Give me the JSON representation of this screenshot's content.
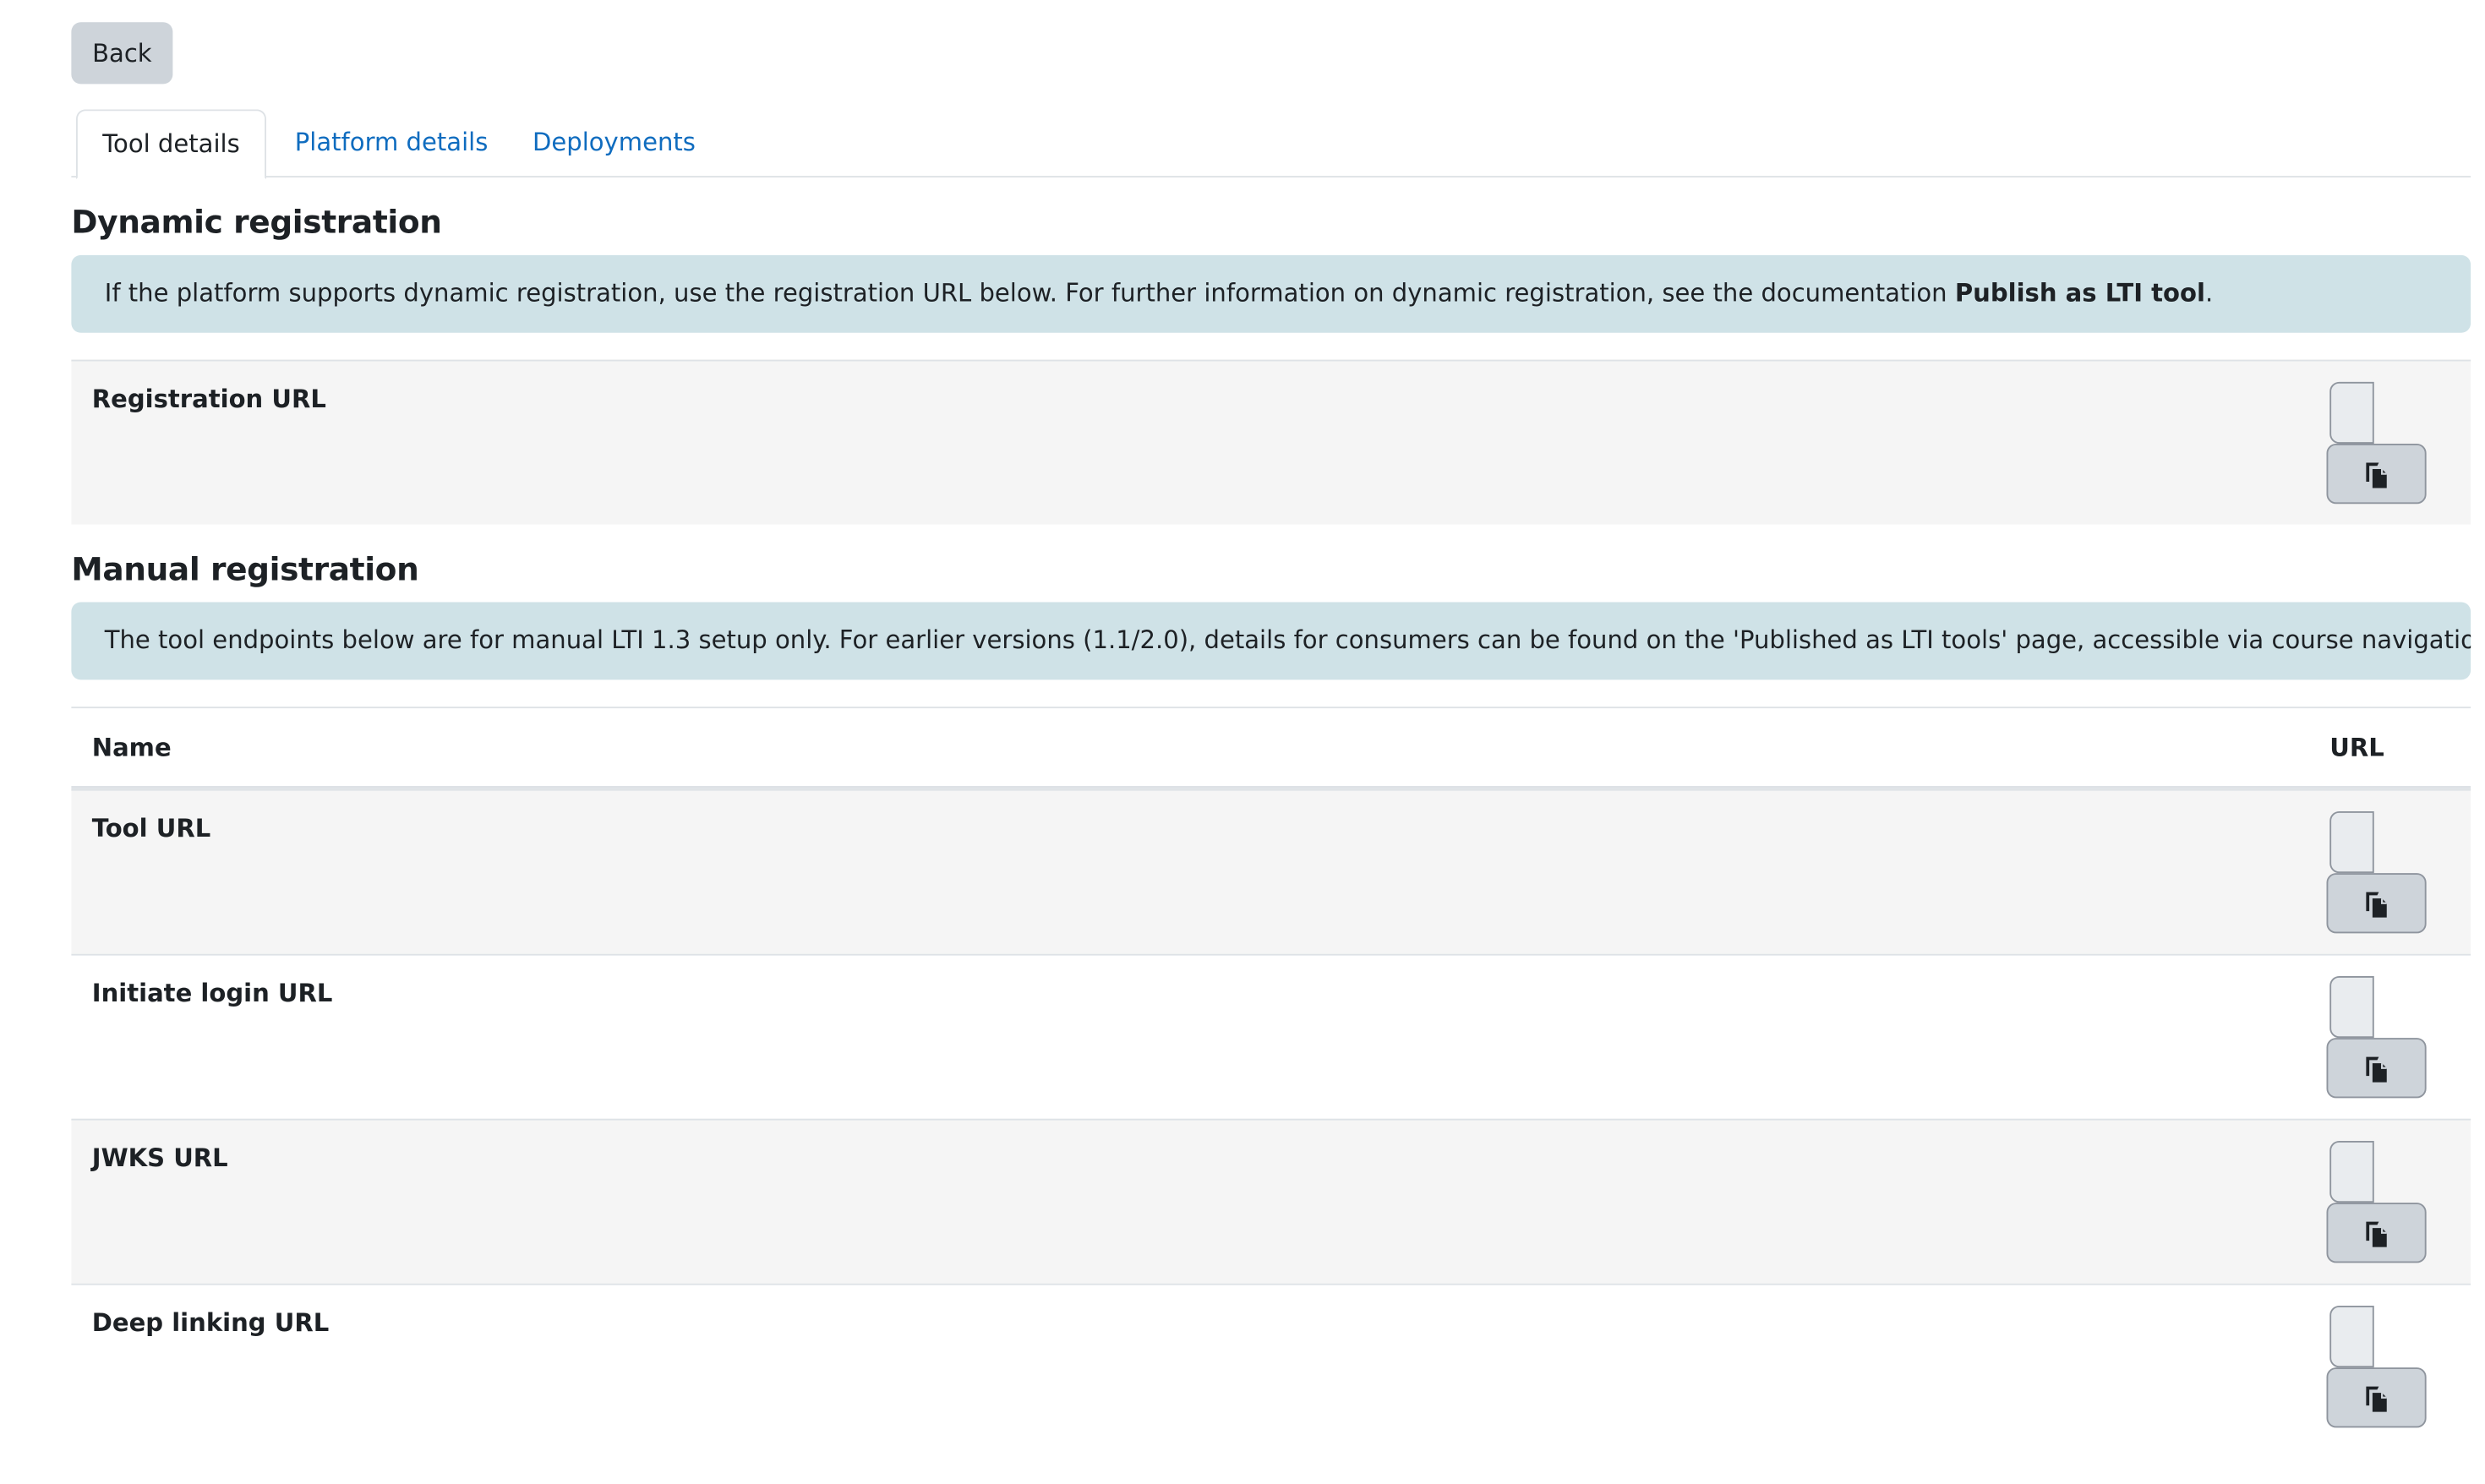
{
  "back_label": "Back",
  "tabs": [
    {
      "label": "Tool details",
      "active": true
    },
    {
      "label": "Platform details",
      "active": false
    },
    {
      "label": "Deployments",
      "active": false
    }
  ],
  "dynamic": {
    "heading": "Dynamic registration",
    "info_text": "If the platform supports dynamic registration, use the registration URL below. For further information on dynamic registration, see the documentation ",
    "info_link": "Publish as LTI tool",
    "info_end": ".",
    "row_label": "Registration URL"
  },
  "manual": {
    "heading": "Manual registration",
    "info_text": "The tool endpoints below are for manual LTI 1.3 setup only. For earlier versions (1.1/2.0), details for consumers can be found on the 'Published as LTI tools' page, accessible via course navigation.",
    "columns": [
      "Name",
      "URL"
    ],
    "rows": [
      {
        "label": "Tool URL"
      },
      {
        "label": "Initiate login URL"
      },
      {
        "label": "JWKS URL"
      },
      {
        "label": "Deep linking URL"
      }
    ]
  },
  "icons": {
    "copy": "copy-icon"
  },
  "colors": {
    "link": "#0f6cbf",
    "alert_bg": "#cfe2e7",
    "button_bg": "#ced4da"
  }
}
